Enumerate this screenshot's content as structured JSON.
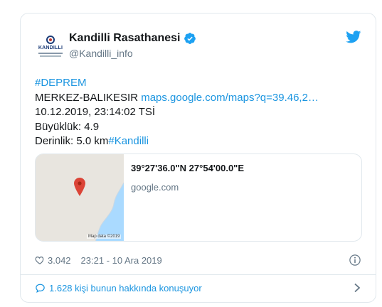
{
  "account": {
    "display_name": "Kandilli Rasathanesi",
    "handle": "@Kandilli_info",
    "avatar_text": "KANDILLI"
  },
  "tweet": {
    "hashtag_top": "#DEPREM",
    "location_label": "MERKEZ-BALIKESIR ",
    "map_link": "maps.google.com/maps?q=39.46,2…",
    "datetime_line": "10.12.2019, 23:14:02 TSİ",
    "magnitude_line": "Büyüklük: 4.9",
    "depth_line": "Derinlik: 5.0 km",
    "hashtag_bottom": "#Kandilli"
  },
  "link_card": {
    "title": "39°27'36.0\"N 27°54'00.0\"E",
    "domain": "google.com",
    "map_credit": "Map data ©2019"
  },
  "meta": {
    "likes": "3.042",
    "timestamp": "23:21 - 10 Ara 2019"
  },
  "footer": {
    "talk_label": "1.628 kişi bunun hakkında konuşuyor"
  },
  "colors": {
    "link": "#1b95e0",
    "muted": "#657786",
    "border": "#e1e8ed",
    "pin": "#db4437",
    "water": "#aadaff"
  }
}
